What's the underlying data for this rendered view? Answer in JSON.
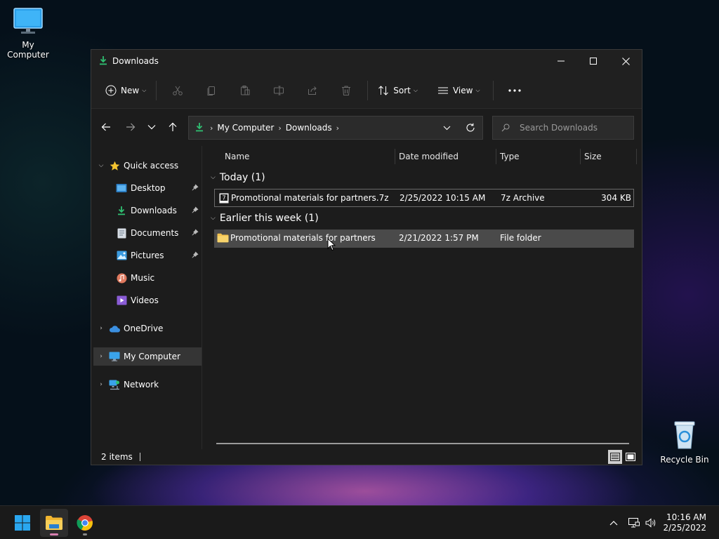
{
  "desktop": {
    "icons": [
      {
        "label": "My Computer"
      },
      {
        "label": "Recycle Bin"
      }
    ]
  },
  "window": {
    "title": "Downloads",
    "toolbar": {
      "new_label": "New",
      "sort_label": "Sort",
      "view_label": "View"
    },
    "address": {
      "crumbs": [
        "My Computer",
        "Downloads"
      ]
    },
    "search": {
      "placeholder": "Search Downloads"
    },
    "sidebar": {
      "quick_access": "Quick access",
      "items": [
        {
          "label": "Desktop",
          "pinned": true
        },
        {
          "label": "Downloads",
          "pinned": true
        },
        {
          "label": "Documents",
          "pinned": true
        },
        {
          "label": "Pictures",
          "pinned": true
        },
        {
          "label": "Music",
          "pinned": false
        },
        {
          "label": "Videos",
          "pinned": false
        }
      ],
      "onedrive": "OneDrive",
      "my_computer": "My Computer",
      "network": "Network"
    },
    "columns": [
      "Name",
      "Date modified",
      "Type",
      "Size"
    ],
    "groups": [
      {
        "title": "Today (1)",
        "rows": [
          {
            "name": "Promotional materials for partners.7z",
            "date": "2/25/2022 10:15 AM",
            "type": "7z Archive",
            "size": "304 KB"
          }
        ]
      },
      {
        "title": "Earlier this week (1)",
        "rows": [
          {
            "name": "Promotional materials for partners",
            "date": "2/21/2022 1:57 PM",
            "type": "File folder",
            "size": ""
          }
        ]
      }
    ],
    "status": {
      "items": "2 items"
    }
  },
  "taskbar": {
    "clock_time": "10:16 AM",
    "clock_date": "2/25/2022"
  },
  "colors": {
    "accent_green": "#2fbf71",
    "folder_yellow": "#f2c14e",
    "quick_access_star": "#f4c430",
    "onedrive_blue": "#3b8fe0"
  }
}
